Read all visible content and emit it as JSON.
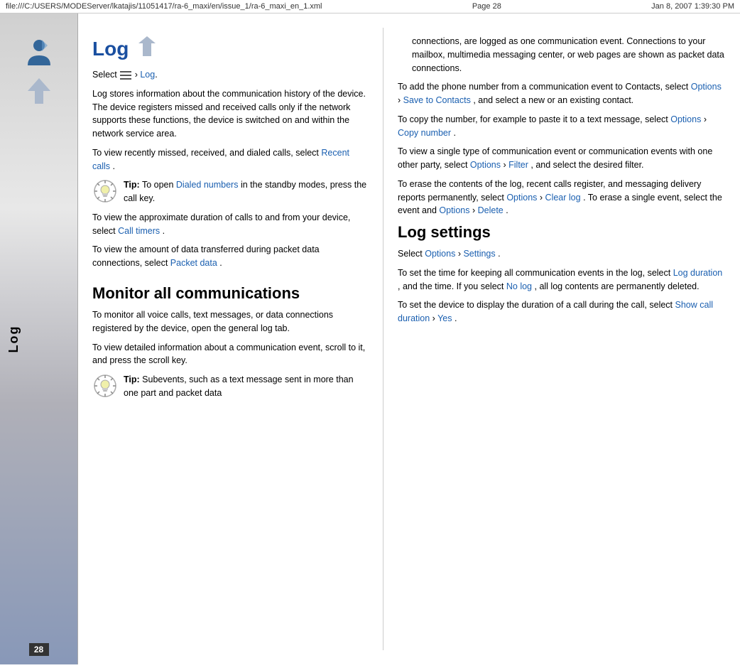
{
  "topbar": {
    "filepath": "file:///C:/USERS/MODEServer/lkatajis/11051417/ra-6_maxi/en/issue_1/ra-6_maxi_en_1.xml",
    "page_label": "Page 28",
    "date_label": "Jan 8, 2007 1:39:30 PM"
  },
  "sidebar": {
    "label": "Log",
    "page_number": "28"
  },
  "left_column": {
    "main_title": "Log",
    "intro_select": "Select",
    "intro_arrow": "›",
    "intro_link": "Log",
    "intro_text": ".",
    "para1": "Log stores information about the communication history of the device. The device registers missed and received calls only if the network supports these functions, the device is switched on and within the network service area.",
    "para2_prefix": "To view recently missed, received, and dialed calls, select",
    "para2_link": "Recent calls",
    "para2_suffix": ".",
    "tip1_label": "Tip:",
    "tip1_text": "To open",
    "tip1_link": "Dialed numbers",
    "tip1_text2": "in the standby modes, press the call key.",
    "para3_prefix": "To view the approximate duration of calls to and from your device, select",
    "para3_link": "Call timers",
    "para3_suffix": ".",
    "para4_prefix": "To view the amount of data transferred during packet data connections, select",
    "para4_link": "Packet data",
    "para4_suffix": ".",
    "sub_title": "Monitor all communications",
    "para5": "To monitor all voice calls, text messages, or data connections registered by the device, open the general log tab.",
    "para6": "To view detailed information about a communication event, scroll to it, and press the scroll key.",
    "tip2_label": "Tip:",
    "tip2_text": "Subevents, such as a text message sent in more than one part and packet data"
  },
  "right_column": {
    "para_cont": "connections, are logged as one communication event. Connections to your mailbox, multimedia messaging center, or web pages are shown as packet data connections.",
    "para1_prefix": "To add the phone number from a communication event to Contacts, select",
    "para1_options": "Options",
    "para1_arrow": "›",
    "para1_link": "Save to Contacts",
    "para1_suffix": ", and select a new or an existing contact.",
    "para2_prefix": "To copy the number, for example to paste it to a text message, select",
    "para2_options": "Options",
    "para2_arrow": "›",
    "para2_link": "Copy number",
    "para2_suffix": ".",
    "para3_prefix": "To view a single type of communication event or communication events with one other party, select",
    "para3_options": "Options",
    "para3_arrow": "›",
    "para3_link": "Filter",
    "para3_suffix": ", and select the desired filter.",
    "para4_prefix": "To erase the contents of the log, recent calls register, and messaging delivery reports permanently, select",
    "para4_options": "Options",
    "para4_arrow": "›",
    "para4_link": "Clear log",
    "para4_mid": ". To erase a single event, select the event and",
    "para4_options2": "Options",
    "para4_arrow2": "›",
    "para4_link2": "Delete",
    "para4_suffix": ".",
    "sub_title": "Log settings",
    "select_prefix": "Select",
    "select_options": "Options",
    "select_arrow": "›",
    "select_link": "Settings",
    "select_suffix": ".",
    "para5_prefix": "To set the time for keeping all communication events in the log, select",
    "para5_link": "Log duration",
    "para5_mid": ", and the time. If you select",
    "para5_link2": "No log",
    "para5_suffix": ", all log contents are permanently deleted.",
    "para6_prefix": "To set the device to display the duration of a call during the call, select",
    "para6_link": "Show call duration",
    "para6_arrow": "›",
    "para6_link2": "Yes",
    "para6_suffix": "."
  }
}
